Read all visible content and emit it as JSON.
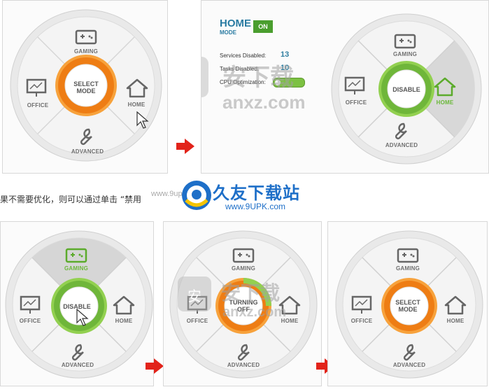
{
  "labels": {
    "gaming": "GAMING",
    "office": "OFFICE",
    "home": "HOME",
    "advanced": "ADVANCED"
  },
  "centers": {
    "select_mode_1": "SELECT",
    "select_mode_2": "MODE",
    "disable": "DISABLE",
    "turning_1": "TURNING",
    "turning_2": "OFF"
  },
  "home_mode_panel": {
    "title": "HOME",
    "subtitle": "MODE",
    "toggle": "ON",
    "services_label": "Services Disabled:",
    "services_value": "13",
    "tasks_label": "Tasks Disabled:",
    "tasks_value": "10",
    "cpu_label": "CPU Optimization:"
  },
  "caption_text": "果不需要优化，则可以通过单击 “禁用",
  "watermark": {
    "site_cn": "久友下载站",
    "site_url": "www.9UPK.com",
    "small_url": "www.9upk.com",
    "anxz_cn": "安下载",
    "anxz_url": "anxz.com",
    "an_char": "安"
  },
  "colors": {
    "orange": "#f28a1e",
    "green": "#7cc142",
    "arrow_red": "#e2231a"
  }
}
